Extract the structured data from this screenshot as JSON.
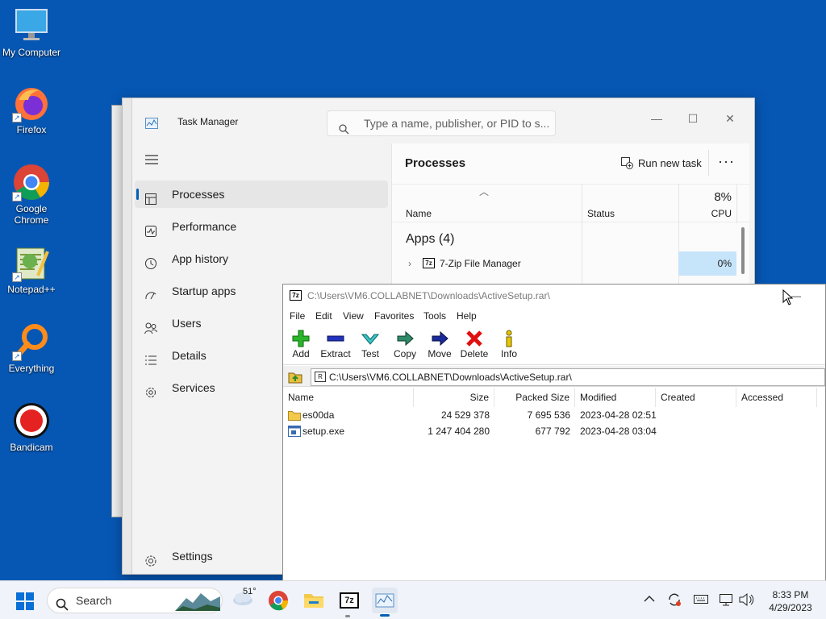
{
  "desktop": {
    "icons": [
      {
        "label": "My Computer"
      },
      {
        "label": "Firefox"
      },
      {
        "label": "Google Chrome"
      },
      {
        "label": "Notepad++"
      },
      {
        "label": "Everything"
      },
      {
        "label": "Bandicam"
      }
    ]
  },
  "task_manager": {
    "title": "Task Manager",
    "search_placeholder": "Type a name, publisher, or PID to s...",
    "nav": [
      "Processes",
      "Performance",
      "App history",
      "Startup apps",
      "Users",
      "Details",
      "Services"
    ],
    "settings": "Settings",
    "header": "Processes",
    "run_new_task": "Run new task",
    "columns": {
      "name": "Name",
      "status": "Status",
      "cpu_pct": "8%",
      "cpu": "CPU"
    },
    "group": "Apps (4)",
    "rows": [
      {
        "name": "7-Zip File Manager",
        "cpu": "0%"
      }
    ]
  },
  "zip": {
    "title": "C:\\Users\\VM6.COLLABNET\\Downloads\\ActiveSetup.rar\\",
    "menu": [
      "File",
      "Edit",
      "View",
      "Favorites",
      "Tools",
      "Help"
    ],
    "toolbar": [
      "Add",
      "Extract",
      "Test",
      "Copy",
      "Move",
      "Delete",
      "Info"
    ],
    "address": "C:\\Users\\VM6.COLLABNET\\Downloads\\ActiveSetup.rar\\",
    "columns": [
      "Name",
      "Size",
      "Packed Size",
      "Modified",
      "Created",
      "Accessed"
    ],
    "files": [
      {
        "name": "es00da",
        "size": "24 529 378",
        "packed": "7 695 536",
        "modified": "2023-04-28 02:51",
        "type": "folder"
      },
      {
        "name": "setup.exe",
        "size": "1 247 404 280",
        "packed": "677 792",
        "modified": "2023-04-28 03:04",
        "type": "exe"
      }
    ]
  },
  "taskbar": {
    "search": "Search",
    "weather_temp": "51°",
    "time": "8:33 PM",
    "date": "4/29/2023"
  },
  "colors": {
    "desktop": "#0657b4",
    "accent": "#005fb8",
    "cpu_highlight": "#c6e4fa"
  }
}
